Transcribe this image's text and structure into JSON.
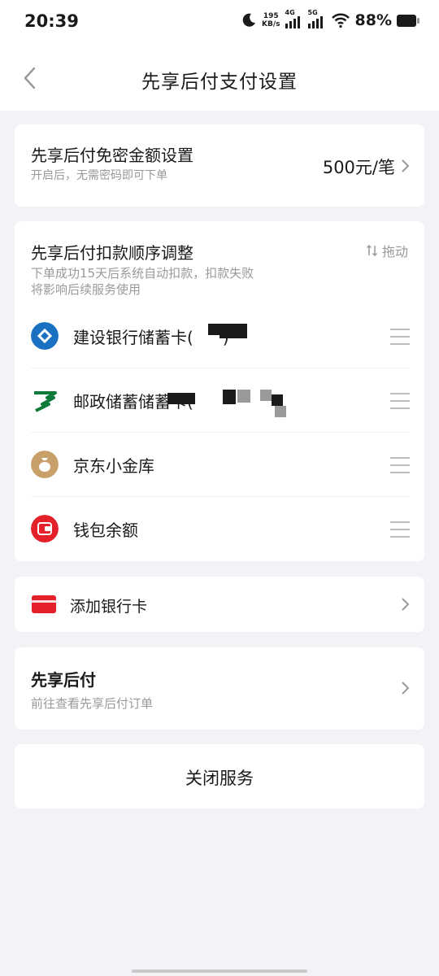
{
  "status_bar": {
    "time": "20:39",
    "net_speed_value": "195",
    "net_speed_unit": "KB/s",
    "signal1_label": "4G",
    "signal2_label": "5G",
    "battery": "88%"
  },
  "header": {
    "title": "先享后付支付设置"
  },
  "free_pwd": {
    "title": "先享后付免密金额设置",
    "subtitle": "开启后，无需密码即可下单",
    "value": "500元/笔"
  },
  "deduct_order": {
    "title": "先享后付扣款顺序调整",
    "drag_label": "拖动",
    "description_line1": "下单成功15天后系统自动扣款，扣款失败",
    "description_line2": "将影响后续服务使用",
    "items": [
      {
        "label": "建设银行储蓄卡(",
        "tail": ")",
        "icon": "ccb-bank-icon",
        "color": "#1a71c2"
      },
      {
        "label": "邮政储蓄储蓄卡(",
        "tail": "",
        "icon": "psbc-bank-icon",
        "color": "#0e7a3a"
      },
      {
        "label": "京东小金库",
        "tail": "",
        "icon": "money-bag-icon",
        "color": "#c8a06a"
      },
      {
        "label": "钱包余额",
        "tail": "",
        "icon": "wallet-icon",
        "color": "#e4202b"
      }
    ]
  },
  "add_card": {
    "label": "添加银行卡"
  },
  "bnpl": {
    "title": "先享后付",
    "subtitle": "前往查看先享后付订单"
  },
  "close_service": {
    "label": "关闭服务"
  },
  "colors": {
    "background": "#f3f3f7",
    "card": "#ffffff",
    "accent_red": "#e4202b",
    "muted_text": "#999999"
  }
}
